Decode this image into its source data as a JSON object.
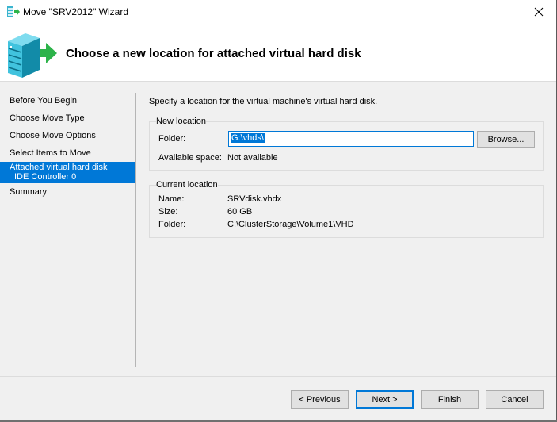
{
  "window": {
    "title": "Move \"SRV2012\" Wizard",
    "close_icon": "close-icon"
  },
  "header": {
    "title": "Choose a new location for attached virtual hard disk",
    "icon": "server-move-icon"
  },
  "sidebar": {
    "items": [
      {
        "label": "Before You Begin",
        "sub": ""
      },
      {
        "label": "Choose Move Type",
        "sub": ""
      },
      {
        "label": "Choose Move Options",
        "sub": ""
      },
      {
        "label": "Select Items to Move",
        "sub": ""
      },
      {
        "label": "Attached virtual hard disk",
        "sub": "IDE Controller 0",
        "active": true
      },
      {
        "label": "Summary",
        "sub": ""
      }
    ]
  },
  "main": {
    "intro": "Specify a location for the virtual machine's virtual hard disk.",
    "new_location": {
      "title": "New location",
      "folder_label": "Folder:",
      "folder_value": "G:\\vhds\\",
      "browse_label": "Browse...",
      "available_label": "Available space:",
      "available_value": "Not available"
    },
    "current_location": {
      "title": "Current location",
      "name_label": "Name:",
      "name_value": "SRVdisk.vhdx",
      "size_label": "Size:",
      "size_value": "60 GB",
      "folder_label": "Folder:",
      "folder_value": "C:\\ClusterStorage\\Volume1\\VHD"
    }
  },
  "footer": {
    "previous_label": "< Previous",
    "next_label": "Next >",
    "finish_label": "Finish",
    "cancel_label": "Cancel"
  },
  "colors": {
    "accent": "#0078d7",
    "icon_green": "#2db34a",
    "icon_teal": "#1fa9c9"
  }
}
